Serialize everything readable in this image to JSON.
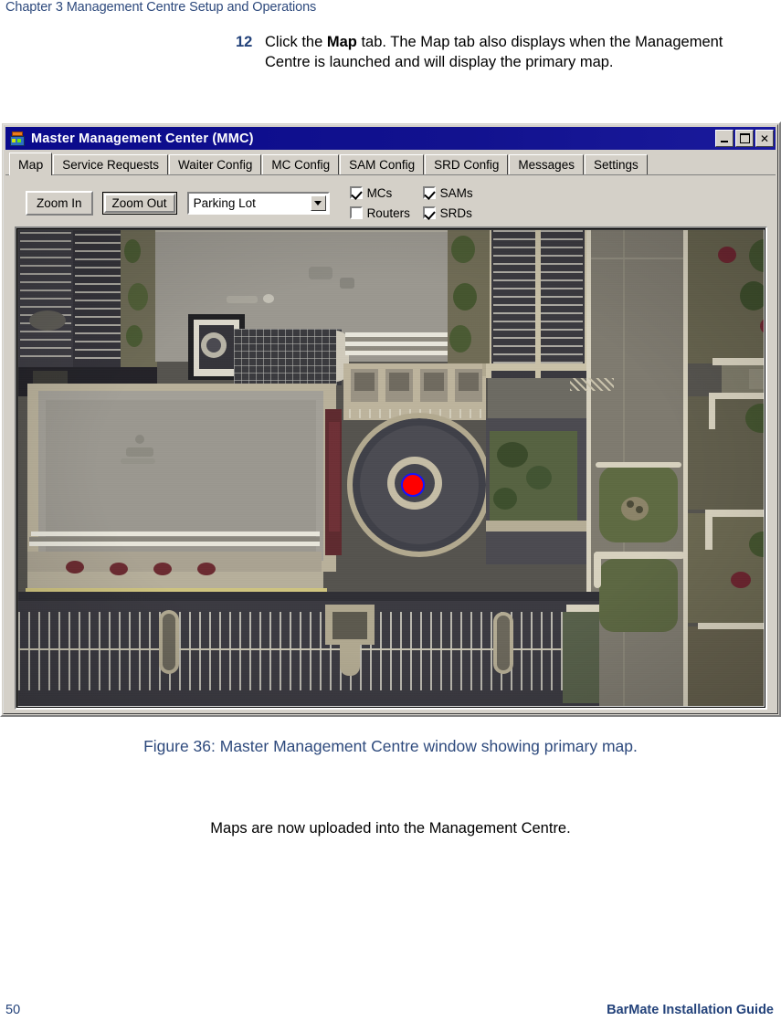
{
  "document": {
    "running_head": "Chapter 3 Management Centre Setup and Operations",
    "footer_page_number": "50",
    "footer_title": "BarMate Installation Guide",
    "caption": "Figure 36: Master Management Centre window showing primary map.",
    "closing_line": "Maps are now uploaded into the Management Centre."
  },
  "step": {
    "number": "12",
    "text_before_bold": "Click the ",
    "bold_term": "Map",
    "text_after_bold": " tab. The Map tab also displays when the Management Centre is launched and will display the primary map."
  },
  "window": {
    "title": "Master Management Center (MMC)",
    "icon": "mmc-app-icon",
    "controls": {
      "minimize": "minimize-button",
      "maximize": "maximize-button",
      "close_label": "✕"
    },
    "tabs": [
      {
        "label": "Map",
        "active": true
      },
      {
        "label": "Service Requests",
        "active": false
      },
      {
        "label": "Waiter Config",
        "active": false
      },
      {
        "label": "MC Config",
        "active": false
      },
      {
        "label": "SAM Config",
        "active": false
      },
      {
        "label": "SRD Config",
        "active": false
      },
      {
        "label": "Messages",
        "active": false
      },
      {
        "label": "Settings",
        "active": false
      }
    ],
    "toolbar": {
      "zoom_in_label": "Zoom In",
      "zoom_out_label": "Zoom Out",
      "map_select": {
        "value": "Parking Lot",
        "options": [
          "Parking Lot"
        ]
      },
      "checkboxes": [
        {
          "label": "MCs",
          "checked": true
        },
        {
          "label": "SAMs",
          "checked": true
        },
        {
          "label": "Routers",
          "checked": false
        },
        {
          "label": "SRDs",
          "checked": true
        }
      ]
    },
    "map": {
      "description": "aerial-satellite-view-of-office-campus-with-parking-lot",
      "marker": {
        "name": "device-marker",
        "fill": "#ff0000",
        "stroke": "#1414ff"
      }
    }
  },
  "colors": {
    "heading_blue": "#2e4a7d",
    "titlebar_blue": "#0a0a8c",
    "window_face": "#d4d0c8",
    "marker_red": "#ff0000",
    "marker_outline_blue": "#1414ff"
  }
}
